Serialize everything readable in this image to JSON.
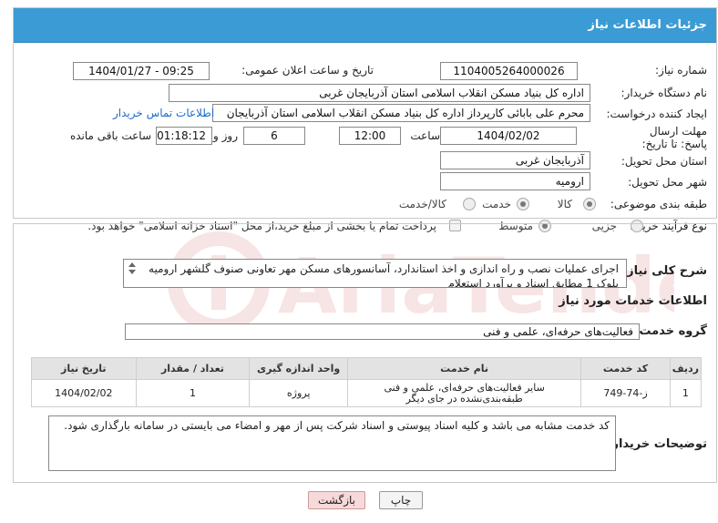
{
  "header": {
    "title": "جزئیات اطلاعات نیاز"
  },
  "fields": {
    "need_number_label": "شماره نیاز:",
    "need_number": "1104005264000026",
    "announce_label": "تاریخ و ساعت اعلان عمومی:",
    "announce_value": "1404/01/27 - 09:25",
    "buyer_org_label": "نام دستگاه خریدار:",
    "buyer_org": "اداره کل بنیاد مسکن انقلاب اسلامی استان آذربایجان غربی",
    "creator_label": "ایجاد کننده درخواست:",
    "creator": "محرم علی بابائی کارپرداز اداره کل بنیاد مسکن انقلاب اسلامی استان آذربایجان",
    "contact_link": "اطلاعات تماس خریدار",
    "deadline_label": "مهلت ارسال پاسخ: تا تاریخ:",
    "deadline_date": "1404/02/02",
    "time_label": "ساعت",
    "deadline_time": "12:00",
    "days_value": "6",
    "days_label": "روز و",
    "remaining_time": "01:18:12",
    "remaining_label": "ساعت باقی مانده",
    "province_label": "استان محل تحویل:",
    "province": "آذربایجان غربی",
    "city_label": "شهر محل تحویل:",
    "city": "ارومیه",
    "category_label": "طبقه بندی موضوعی:",
    "category_options": [
      "کالا",
      "خدمت",
      "کالا/خدمت"
    ],
    "purchase_label": "نوع فرآیند خرید :",
    "purchase_options": [
      "جزیی",
      "متوسط"
    ],
    "treasury_note": "پرداخت تمام یا بخشی از مبلغ خرید،از محل \"اسناد خزانه اسلامی\" خواهد بود."
  },
  "description": {
    "label": "شرح کلی نیاز:",
    "text": "اجرای عملیات نصب و راه اندازی و اخذ استاندارد، آسانسورهای مسکن مهر تعاونی صنوف گلشهر ارومیه بلوک 1 مطابق اسناد و برآورد استعلام"
  },
  "services": {
    "section_title": "اطلاعات خدمات مورد نیاز",
    "group_label": "گروه خدمت:",
    "group_value": "فعالیت‌های حرفه‌ای، علمی و فنی",
    "columns": [
      "ردیف",
      "کد خدمت",
      "نام خدمت",
      "واحد اندازه گیری",
      "تعداد / مقدار",
      "تاریخ نیاز"
    ],
    "rows": [
      [
        "1",
        "ز-74-749",
        "سایر فعالیت‌های حرفه‌ای، علمی و فنی طبقه‌بندی‌نشده در جای دیگر",
        "پروژه",
        "1",
        "1404/02/02"
      ]
    ]
  },
  "buyer_notes": {
    "label": "توضیحات خریدار:",
    "text": "کد خدمت مشابه می باشد و کلیه اسناد پیوستی و اسناد شرکت پس از مهر و امضاء می بایستی در سامانه بارگذاری شود."
  },
  "buttons": {
    "print": "چاپ",
    "back": "بازگشت"
  },
  "colors": {
    "header_bg": "#3a9bd5",
    "link": "#1c6bc9",
    "back_btn": "#f7d9d9"
  }
}
